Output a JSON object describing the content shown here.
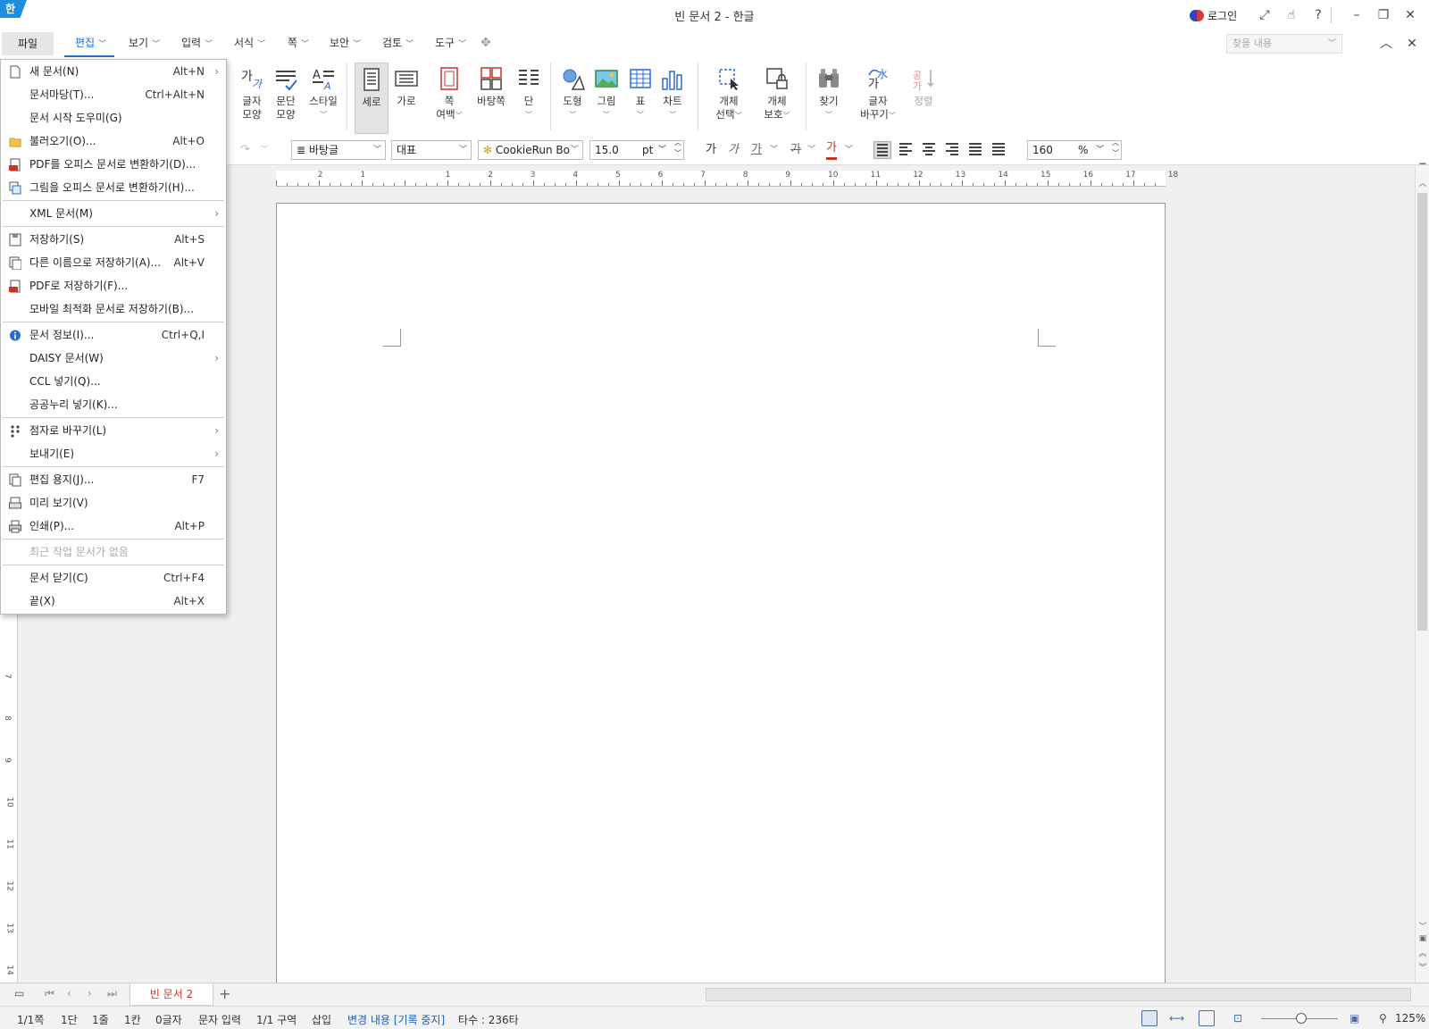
{
  "window": {
    "logo": "한",
    "title": "빈 문서 2 - 한글",
    "login_label": "로그인"
  },
  "menubar": {
    "file": "파일",
    "tabs": [
      "편집",
      "보기",
      "입력",
      "서식",
      "쪽",
      "보안",
      "검토",
      "도구"
    ],
    "search_placeholder": "찾을 내용"
  },
  "ribbon": {
    "char_shape": [
      "글자",
      "모양"
    ],
    "para_shape": [
      "문단",
      "모양"
    ],
    "style": "스타일",
    "portrait": "세로",
    "landscape": "가로",
    "margin": [
      "쪽",
      "여백"
    ],
    "master_page": "바탕쪽",
    "column": "단",
    "shape": "도형",
    "picture": "그림",
    "table": "표",
    "chart": "차트",
    "obj_select": [
      "개체",
      "선택"
    ],
    "obj_protect": [
      "개체",
      "보호"
    ],
    "find": "찾기",
    "replace": [
      "글자",
      "바꾸기"
    ],
    "sort": "정렬"
  },
  "formatbar": {
    "style_value": "바탕글",
    "lang_value": "대표",
    "font_value": "CookieRun Bo",
    "size_value": "15.0",
    "size_unit": "pt",
    "bold": "가",
    "italic": "가",
    "underline": "가",
    "strike": "가",
    "color": "가",
    "line_spacing": "160",
    "line_spacing_unit": "%"
  },
  "ruler": {
    "h_numbers": [
      "2",
      "1",
      "1",
      "2",
      "3",
      "4",
      "5",
      "6",
      "7",
      "8",
      "9",
      "10",
      "11",
      "12",
      "13",
      "14",
      "15",
      "16",
      "17",
      "18"
    ],
    "v_numbers": [
      "7",
      "8",
      "9",
      "10",
      "11",
      "12",
      "13",
      "14"
    ]
  },
  "file_menu": {
    "groups": [
      [
        {
          "label": "새 문서(N)",
          "shortcut": "Alt+N",
          "submenu": true,
          "icon": "new-doc-icon"
        },
        {
          "label": "문서마당(T)...",
          "shortcut": "Ctrl+Alt+N",
          "submenu": false,
          "icon": ""
        },
        {
          "label": "문서 시작 도우미(G)",
          "shortcut": "",
          "submenu": false,
          "icon": ""
        },
        {
          "label": "불러오기(O)...",
          "shortcut": "Alt+O",
          "submenu": false,
          "icon": "folder-icon"
        },
        {
          "label": "PDF를 오피스 문서로 변환하기(D)...",
          "shortcut": "",
          "submenu": false,
          "icon": "pdf-icon"
        },
        {
          "label": "그림을 오피스 문서로 변환하기(H)...",
          "shortcut": "",
          "submenu": false,
          "icon": "image-convert-icon"
        }
      ],
      [
        {
          "label": "XML 문서(M)",
          "shortcut": "",
          "submenu": true,
          "icon": ""
        }
      ],
      [
        {
          "label": "저장하기(S)",
          "shortcut": "Alt+S",
          "submenu": false,
          "icon": "save-icon"
        },
        {
          "label": "다른 이름으로 저장하기(A)...",
          "shortcut": "Alt+V",
          "submenu": false,
          "icon": "save-as-icon"
        },
        {
          "label": "PDF로 저장하기(F)...",
          "shortcut": "",
          "submenu": false,
          "icon": "pdf-save-icon"
        },
        {
          "label": "모바일 최적화 문서로 저장하기(B)...",
          "shortcut": "",
          "submenu": false,
          "icon": ""
        }
      ],
      [
        {
          "label": "문서 정보(I)...",
          "shortcut": "Ctrl+Q,I",
          "submenu": false,
          "icon": "info-icon"
        },
        {
          "label": "DAISY 문서(W)",
          "shortcut": "",
          "submenu": true,
          "icon": ""
        },
        {
          "label": "CCL 넣기(Q)...",
          "shortcut": "",
          "submenu": false,
          "icon": ""
        },
        {
          "label": "공공누리 넣기(K)...",
          "shortcut": "",
          "submenu": false,
          "icon": ""
        }
      ],
      [
        {
          "label": "점자로 바꾸기(L)",
          "shortcut": "",
          "submenu": true,
          "icon": "braille-icon"
        },
        {
          "label": "보내기(E)",
          "shortcut": "",
          "submenu": true,
          "icon": ""
        }
      ],
      [
        {
          "label": "편집 용지(J)...",
          "shortcut": "F7",
          "submenu": false,
          "icon": "page-setup-icon"
        },
        {
          "label": "미리 보기(V)",
          "shortcut": "",
          "submenu": false,
          "icon": "preview-icon"
        },
        {
          "label": "인쇄(P)...",
          "shortcut": "Alt+P",
          "submenu": false,
          "icon": "print-icon"
        }
      ],
      [
        {
          "label": "최근 작업 문서가 없음",
          "shortcut": "",
          "submenu": false,
          "icon": "",
          "disabled": true
        }
      ],
      [
        {
          "label": "문서 닫기(C)",
          "shortcut": "Ctrl+F4",
          "submenu": false,
          "icon": ""
        },
        {
          "label": "끝(X)",
          "shortcut": "Alt+X",
          "submenu": false,
          "icon": ""
        }
      ]
    ]
  },
  "tabbar": {
    "doc_tab": "빈 문서 2",
    "add": "+"
  },
  "statusbar": {
    "page": "1/1쪽",
    "column": "1단",
    "line": "1줄",
    "char": "1칸",
    "chars": "0글자",
    "mode": "문자 입력",
    "section": "1/1 구역",
    "insert": "삽입",
    "track": "변경 내용 [기록 중지]",
    "typing": "타수 : 236타",
    "zoom": "125%"
  },
  "colors": {
    "accent": "#1a73c8",
    "tab_red": "#d0331f",
    "logo_blue": "#1e8fe0"
  }
}
